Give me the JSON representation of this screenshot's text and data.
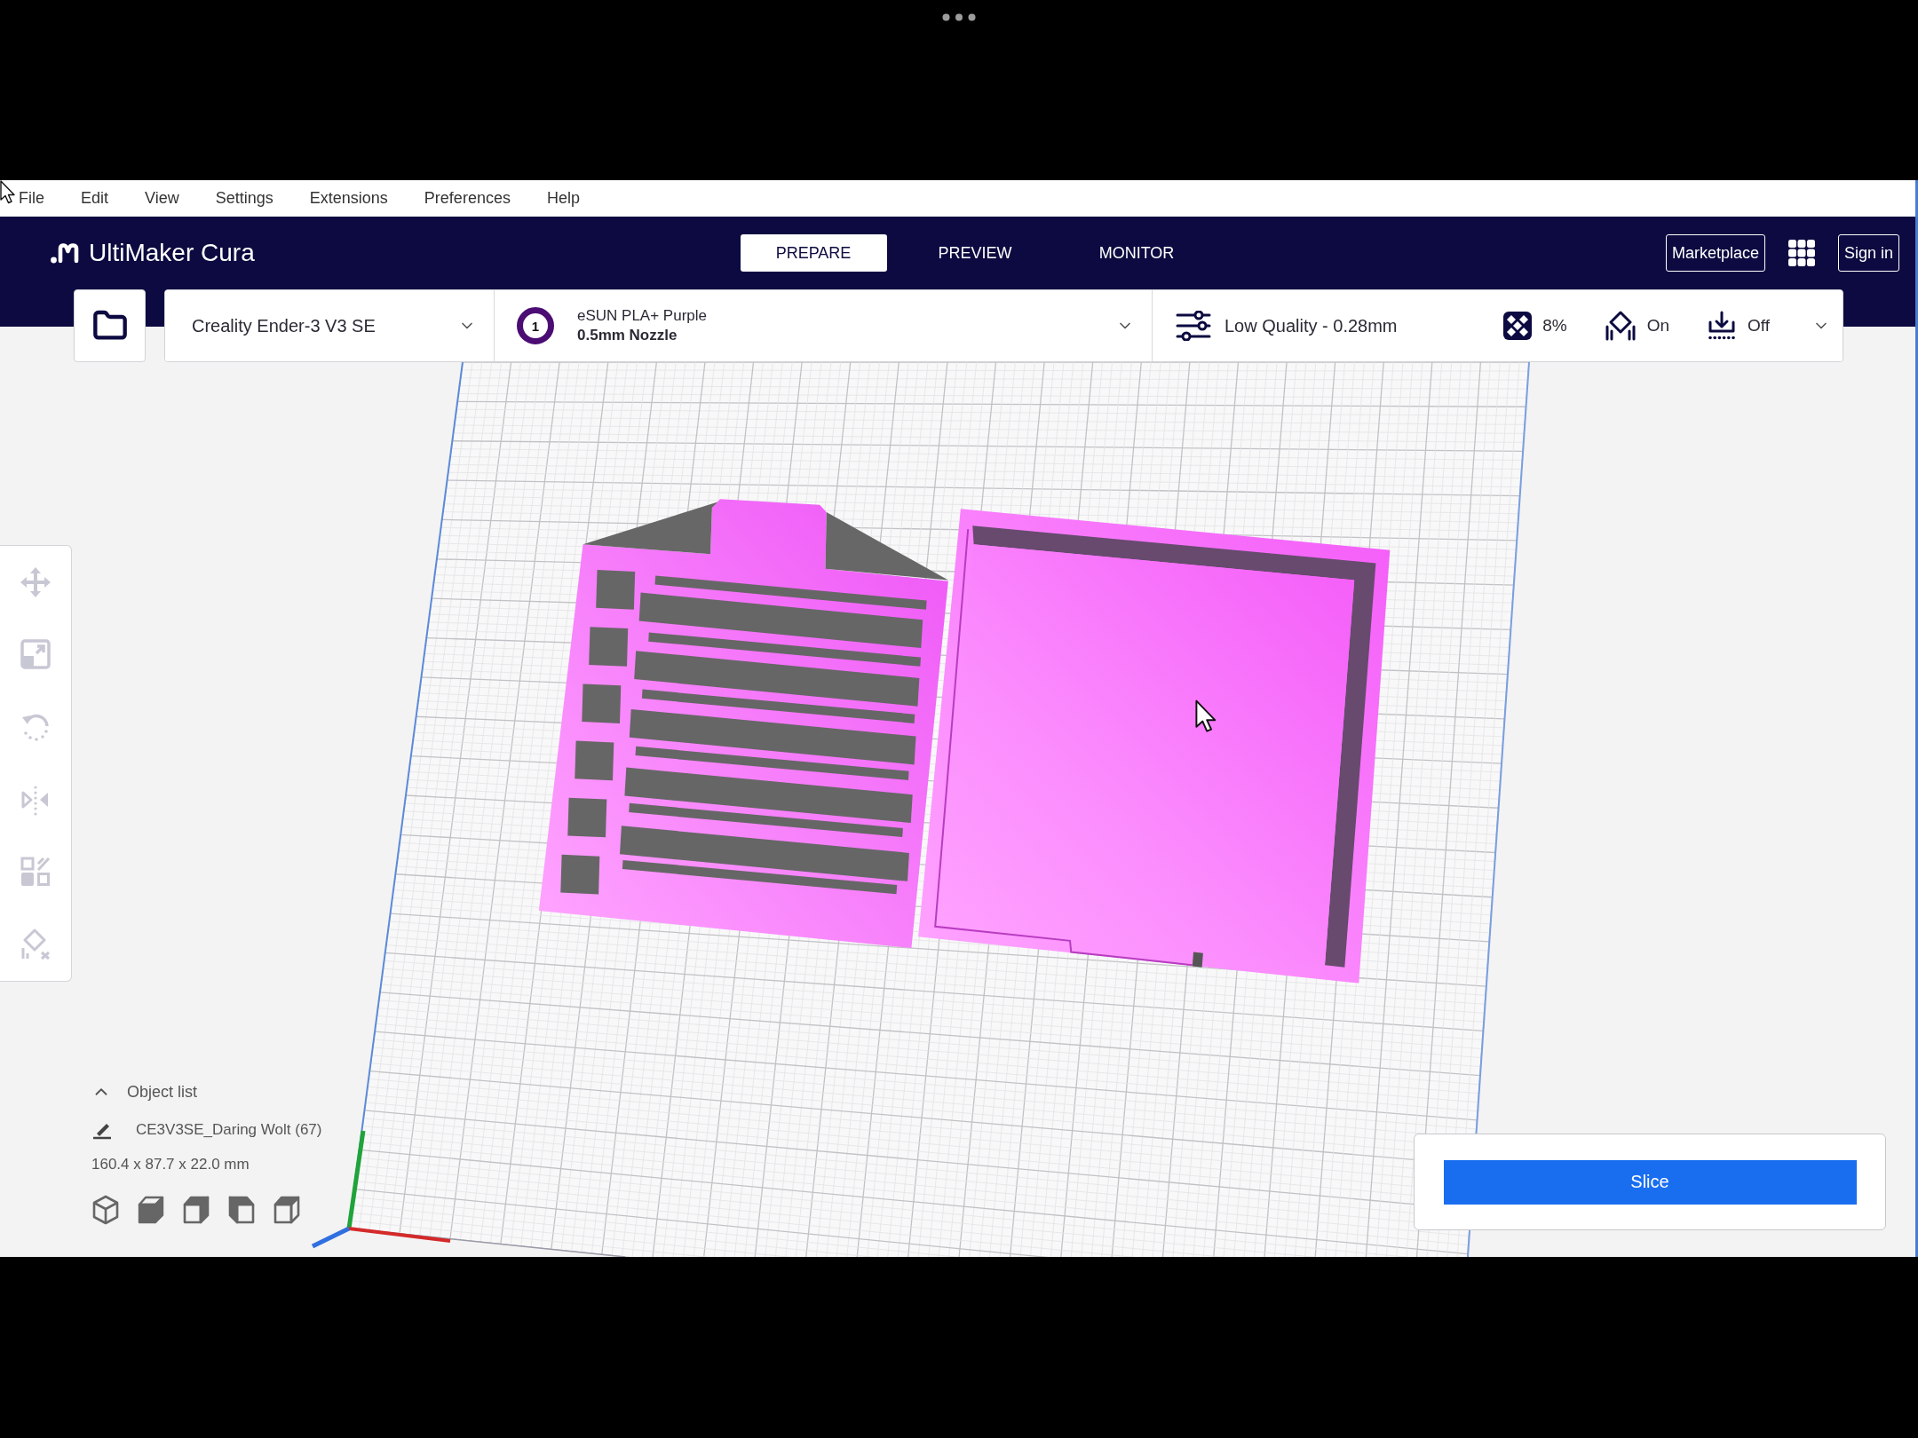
{
  "menu_bar": [
    "File",
    "Edit",
    "View",
    "Settings",
    "Extensions",
    "Preferences",
    "Help"
  ],
  "header": {
    "app_name": "UltiMaker Cura",
    "stages": [
      {
        "label": "PREPARE",
        "selected": true
      },
      {
        "label": "PREVIEW",
        "selected": false
      },
      {
        "label": "MONITOR",
        "selected": false
      }
    ],
    "marketplace": "Marketplace",
    "sign_in": "Sign in"
  },
  "printer": {
    "name": "Creality Ender-3 V3 SE"
  },
  "extruders": [
    {
      "number": "1",
      "color": "#4b0c73",
      "material": "eSUN PLA+ Purple",
      "nozzle": "0.5mm Nozzle"
    }
  ],
  "print_settings": {
    "profile": "Low Quality - 0.28mm",
    "infill": "8%",
    "support": "On",
    "adhesion": "Off"
  },
  "tools": [
    {
      "disabled": true
    },
    {
      "disabled": true
    },
    {
      "disabled": true
    },
    {
      "disabled": true
    },
    {
      "disabled": true
    },
    {
      "disabled": true
    }
  ],
  "object_list": {
    "title": "Object list",
    "expanded": false,
    "current_object": "CE3V3SE_Daring Wolt (67)",
    "dimensions": "160.4 x 87.7 x 22.0 mm"
  },
  "slice_button": {
    "label": "Slice"
  }
}
